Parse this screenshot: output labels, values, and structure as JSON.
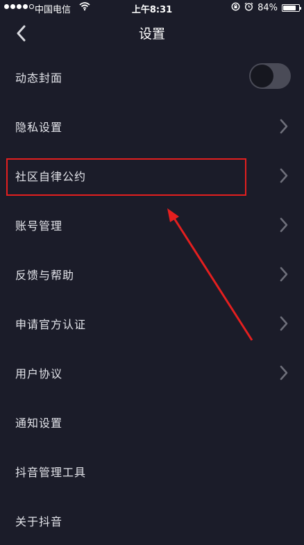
{
  "status_bar": {
    "carrier": "中国电信",
    "time": "上午8:31",
    "battery": "84%",
    "battery_level": 0.84,
    "icons": [
      "signal-dots",
      "wifi-icon",
      "rotation-lock-icon",
      "alarm-icon",
      "battery-icon"
    ]
  },
  "nav": {
    "title": "设置",
    "back_icon": "chevron-left-icon"
  },
  "settings": {
    "items": [
      {
        "label": "动态封面",
        "control": "toggle",
        "toggle_on": false
      },
      {
        "label": "隐私设置",
        "control": "chevron"
      },
      {
        "label": "社区自律公约",
        "control": "chevron",
        "highlighted": true
      },
      {
        "label": "账号管理",
        "control": "chevron"
      },
      {
        "label": "反馈与帮助",
        "control": "chevron"
      },
      {
        "label": "申请官方认证",
        "control": "chevron"
      },
      {
        "label": "用户协议",
        "control": "chevron"
      },
      {
        "label": "通知设置",
        "control": "none"
      },
      {
        "label": "抖音管理工具",
        "control": "none"
      },
      {
        "label": "关于抖音",
        "control": "none"
      }
    ]
  },
  "colors": {
    "background": "#1b1c29",
    "text": "#e3e4ea",
    "chevron": "#6e6f7a",
    "toggle_track": "#4a4b57",
    "annotation": "#e41f1f"
  }
}
